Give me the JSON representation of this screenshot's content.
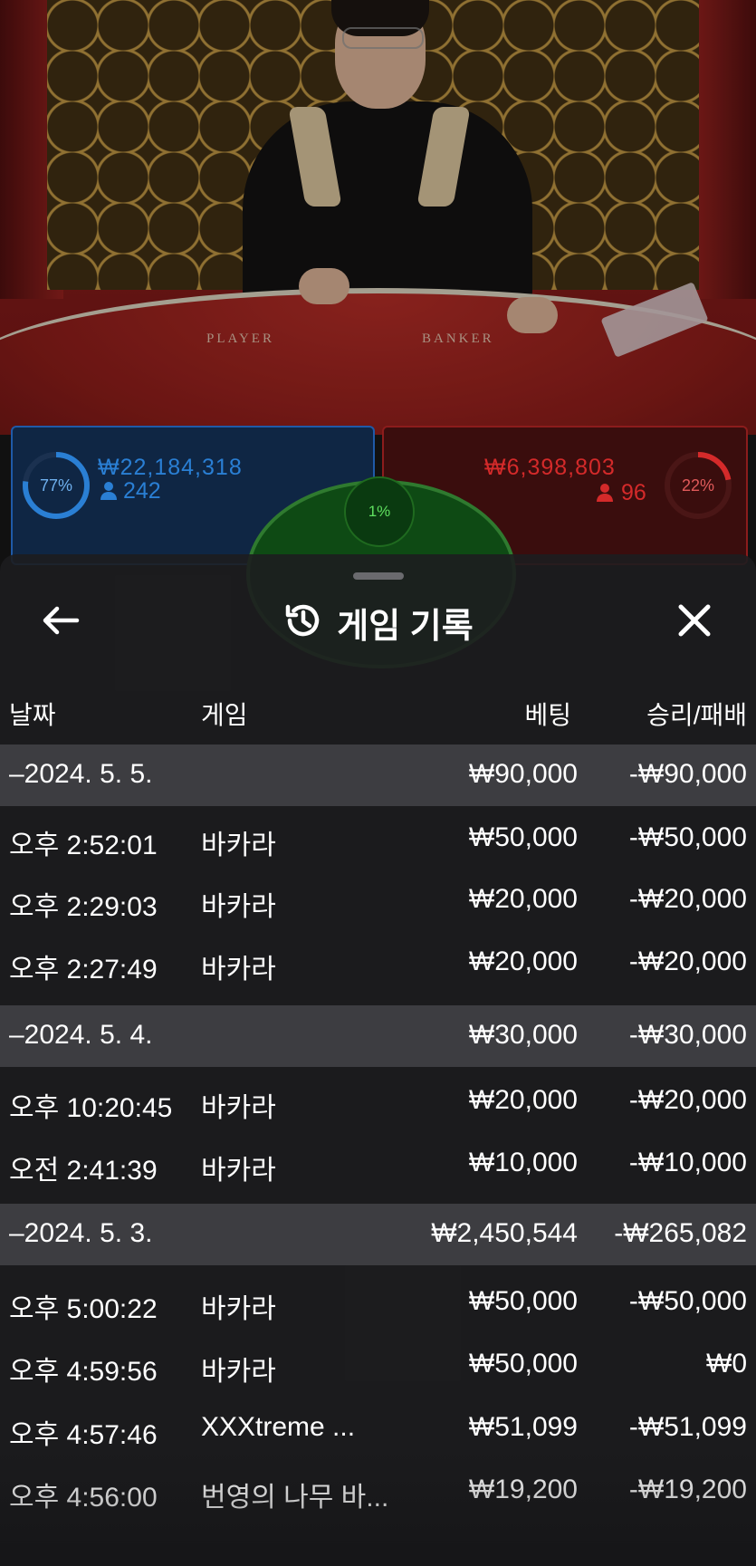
{
  "video": {
    "table_player_label": "PLAYER",
    "table_banker_label": "BANKER"
  },
  "bets": {
    "player": {
      "percent": "77%",
      "amount": "₩22,184,318",
      "players": "242",
      "color": "#2a7fd4"
    },
    "banker": {
      "percent": "22%",
      "amount": "₩6,398,803",
      "players": "96",
      "color": "#d42a2a"
    },
    "tie": {
      "percent": "1%",
      "color": "#3fbf3f"
    }
  },
  "sheet": {
    "title": "게임 기록",
    "back_icon": "arrow-left-icon",
    "history_icon": "history-clock-icon",
    "close_icon": "close-icon",
    "columns": {
      "date": "날짜",
      "game": "게임",
      "bet": "베팅",
      "result": "승리/패배"
    },
    "rows": [
      {
        "type": "group",
        "date": "–2024. 5. 5.",
        "game": "",
        "bet": "₩90,000",
        "result": "-₩90,000"
      },
      {
        "type": "item",
        "date": "오후 2:52:01",
        "game": "바카라",
        "bet": "₩50,000",
        "result": "-₩50,000"
      },
      {
        "type": "item",
        "date": "오후 2:29:03",
        "game": "바카라",
        "bet": "₩20,000",
        "result": "-₩20,000"
      },
      {
        "type": "item",
        "date": "오후 2:27:49",
        "game": "바카라",
        "bet": "₩20,000",
        "result": "-₩20,000"
      },
      {
        "type": "group",
        "date": "–2024. 5. 4.",
        "game": "",
        "bet": "₩30,000",
        "result": "-₩30,000"
      },
      {
        "type": "item",
        "date": "오후 10:20:45",
        "game": "바카라",
        "bet": "₩20,000",
        "result": "-₩20,000"
      },
      {
        "type": "item",
        "date": "오전 2:41:39",
        "game": "바카라",
        "bet": "₩10,000",
        "result": "-₩10,000"
      },
      {
        "type": "group",
        "date": "–2024. 5. 3.",
        "game": "",
        "bet": "₩2,450,544",
        "result": "-₩265,082"
      },
      {
        "type": "item",
        "date": "오후 5:00:22",
        "game": "바카라",
        "bet": "₩50,000",
        "result": "-₩50,000"
      },
      {
        "type": "item",
        "date": "오후 4:59:56",
        "game": "바카라",
        "bet": "₩50,000",
        "result": "₩0"
      },
      {
        "type": "item",
        "date": "오후 4:57:46",
        "game": "XXXtreme ...",
        "bet": "₩51,099",
        "result": "-₩51,099"
      },
      {
        "type": "item",
        "date": "오후 4:56:00",
        "game": "번영의 나무 바...",
        "bet": "₩19,200",
        "result": "-₩19,200"
      }
    ]
  }
}
